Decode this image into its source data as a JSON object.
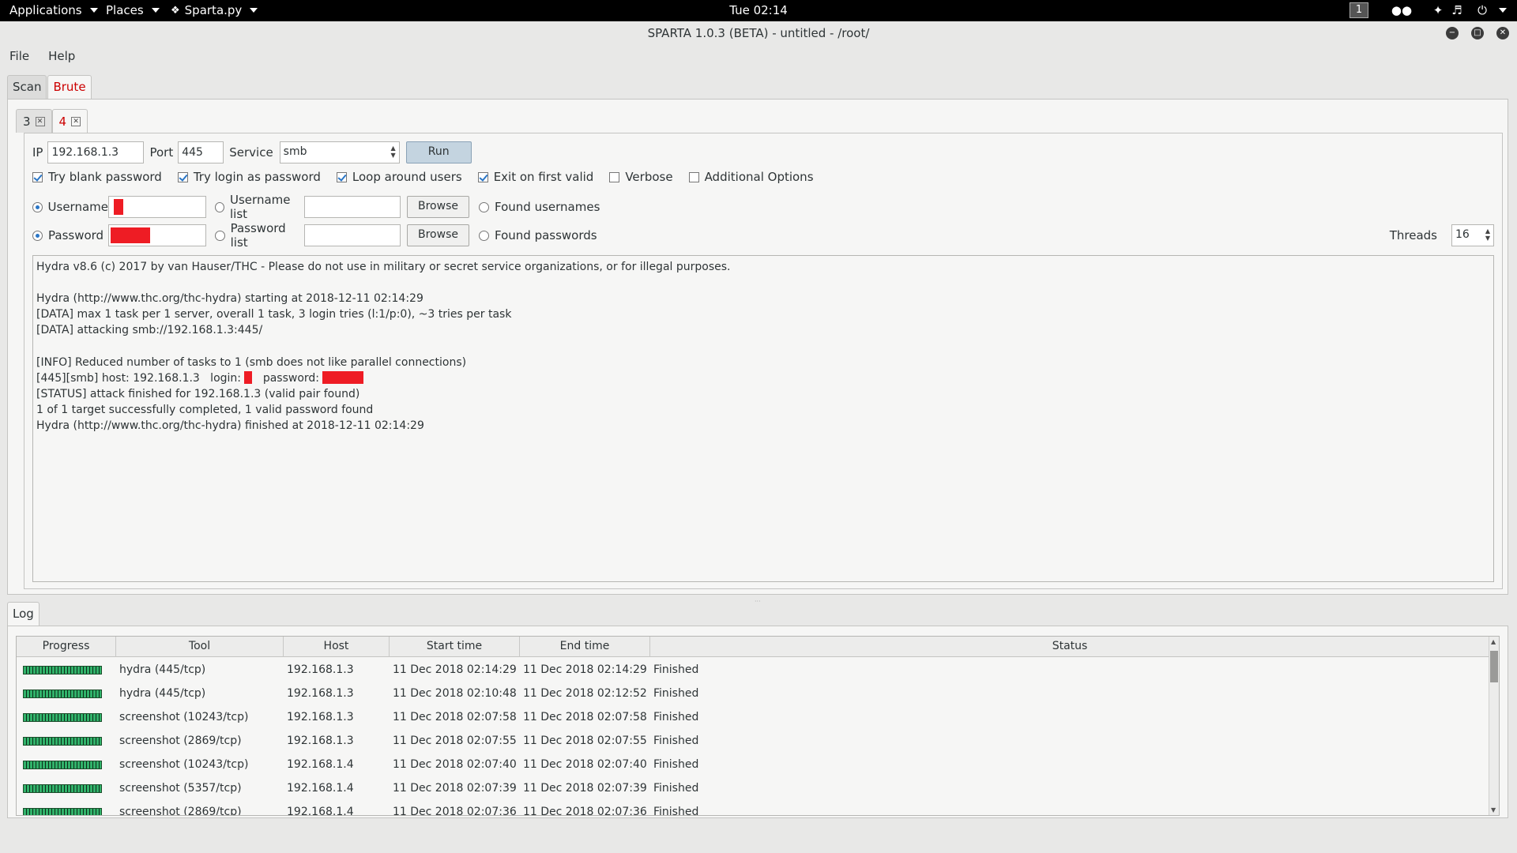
{
  "topbar": {
    "applications": "Applications",
    "places": "Places",
    "app": "Sparta.py",
    "clock": "Tue 02:14",
    "workspace": "1"
  },
  "window": {
    "title": "SPARTA 1.0.3 (BETA) - untitled - /root/"
  },
  "menu": {
    "file": "File",
    "help": "Help"
  },
  "main_tabs": {
    "scan": "Scan",
    "brute": "Brute"
  },
  "sub_tabs": {
    "tab3": "3",
    "tab4": "4"
  },
  "brute": {
    "ip_label": "IP",
    "ip_value": "192.168.1.3",
    "port_label": "Port",
    "port_value": "445",
    "service_label": "Service",
    "service_value": "smb",
    "run": "Run",
    "opt_blank": "Try blank password",
    "opt_login_as_pw": "Try login as password",
    "opt_loop": "Loop around users",
    "opt_exit": "Exit on first valid",
    "opt_verbose": "Verbose",
    "opt_additional": "Additional Options",
    "username_label": "Username",
    "username_list_label": "Username list",
    "browse": "Browse",
    "found_usernames": "Found usernames",
    "password_label": "Password",
    "password_list_label": "Password list",
    "found_passwords": "Found passwords",
    "threads_label": "Threads",
    "threads_value": "16"
  },
  "output": {
    "line1": "Hydra v8.6 (c) 2017 by van Hauser/THC - Please do not use in military or secret service organizations, or for illegal purposes.",
    "line2": "Hydra (http://www.thc.org/thc-hydra) starting at 2018-12-11 02:14:29",
    "line3": "[DATA] max 1 task per 1 server, overall 1 task, 3 login tries (l:1/p:0), ~3 tries per task",
    "line4": "[DATA] attacking smb://192.168.1.3:445/",
    "line5": "[INFO] Reduced number of tasks to 1 (smb does not like parallel connections)",
    "line6_a": "[445][smb] host: 192.168.1.3   login: ",
    "line6_b": "   password: ",
    "line7": "[STATUS] attack finished for 192.168.1.3 (valid pair found)",
    "line8": "1 of 1 target successfully completed, 1 valid password found",
    "line9": "Hydra (http://www.thc.org/thc-hydra) finished at 2018-12-11 02:14:29"
  },
  "log": {
    "tab": "Log",
    "columns": [
      "Progress",
      "Tool",
      "Host",
      "Start time",
      "End time",
      "Status"
    ],
    "rows": [
      {
        "tool": "hydra (445/tcp)",
        "host": "192.168.1.3",
        "start": "11 Dec 2018 02:14:29",
        "end": "11 Dec 2018 02:14:29",
        "status": "Finished"
      },
      {
        "tool": "hydra (445/tcp)",
        "host": "192.168.1.3",
        "start": "11 Dec 2018 02:10:48",
        "end": "11 Dec 2018 02:12:52",
        "status": "Finished"
      },
      {
        "tool": "screenshot (10243/tcp)",
        "host": "192.168.1.3",
        "start": "11 Dec 2018 02:07:58",
        "end": "11 Dec 2018 02:07:58",
        "status": "Finished"
      },
      {
        "tool": "screenshot (2869/tcp)",
        "host": "192.168.1.3",
        "start": "11 Dec 2018 02:07:55",
        "end": "11 Dec 2018 02:07:55",
        "status": "Finished"
      },
      {
        "tool": "screenshot (10243/tcp)",
        "host": "192.168.1.4",
        "start": "11 Dec 2018 02:07:40",
        "end": "11 Dec 2018 02:07:40",
        "status": "Finished"
      },
      {
        "tool": "screenshot (5357/tcp)",
        "host": "192.168.1.4",
        "start": "11 Dec 2018 02:07:39",
        "end": "11 Dec 2018 02:07:39",
        "status": "Finished"
      },
      {
        "tool": "screenshot (2869/tcp)",
        "host": "192.168.1.4",
        "start": "11 Dec 2018 02:07:36",
        "end": "11 Dec 2018 02:07:36",
        "status": "Finished"
      }
    ]
  },
  "colors": {
    "accent": "#cc0000",
    "redaction": "#ee1c24",
    "progress": "#31b26a"
  }
}
